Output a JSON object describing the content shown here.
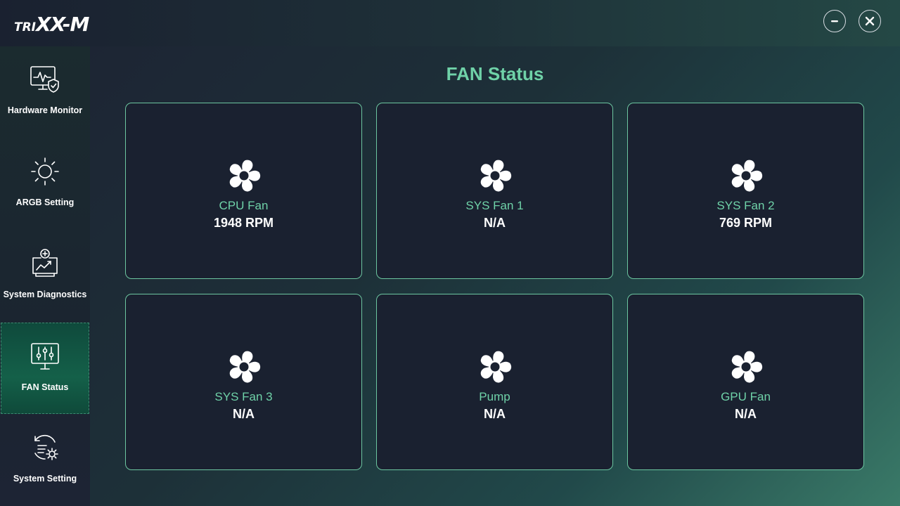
{
  "app": {
    "logo_prefix": "TRI",
    "logo_main": "XX-M"
  },
  "window_controls": {
    "minimize_icon": "minus-circle-icon",
    "close_icon": "x-circle-icon"
  },
  "sidebar": {
    "items": [
      {
        "label": "Hardware Monitor",
        "icon": "monitor-shield-icon",
        "active": false
      },
      {
        "label": "ARGB Setting",
        "icon": "sun-icon",
        "active": false
      },
      {
        "label": "System Diagnostics",
        "icon": "diagnostics-icon",
        "active": false
      },
      {
        "label": "FAN Status",
        "icon": "sliders-monitor-icon",
        "active": true
      },
      {
        "label": "System Setting",
        "icon": "settings-sync-icon",
        "active": false
      }
    ]
  },
  "main": {
    "title": "FAN Status",
    "fans": [
      {
        "name": "CPU Fan",
        "value": "1948 RPM",
        "icon": "fan-icon"
      },
      {
        "name": "SYS Fan 1",
        "value": "N/A",
        "icon": "fan-icon"
      },
      {
        "name": "SYS Fan 2",
        "value": "769 RPM",
        "icon": "fan-icon"
      },
      {
        "name": "SYS Fan 3",
        "value": "N/A",
        "icon": "fan-icon"
      },
      {
        "name": "Pump",
        "value": "N/A",
        "icon": "fan-icon"
      },
      {
        "name": "GPU Fan",
        "value": "N/A",
        "icon": "fan-icon"
      }
    ]
  },
  "colors": {
    "accent": "#6fd2a8",
    "card_bg": "#1a2130",
    "card_border": "#6cc6a0",
    "active_nav": "#146049"
  }
}
